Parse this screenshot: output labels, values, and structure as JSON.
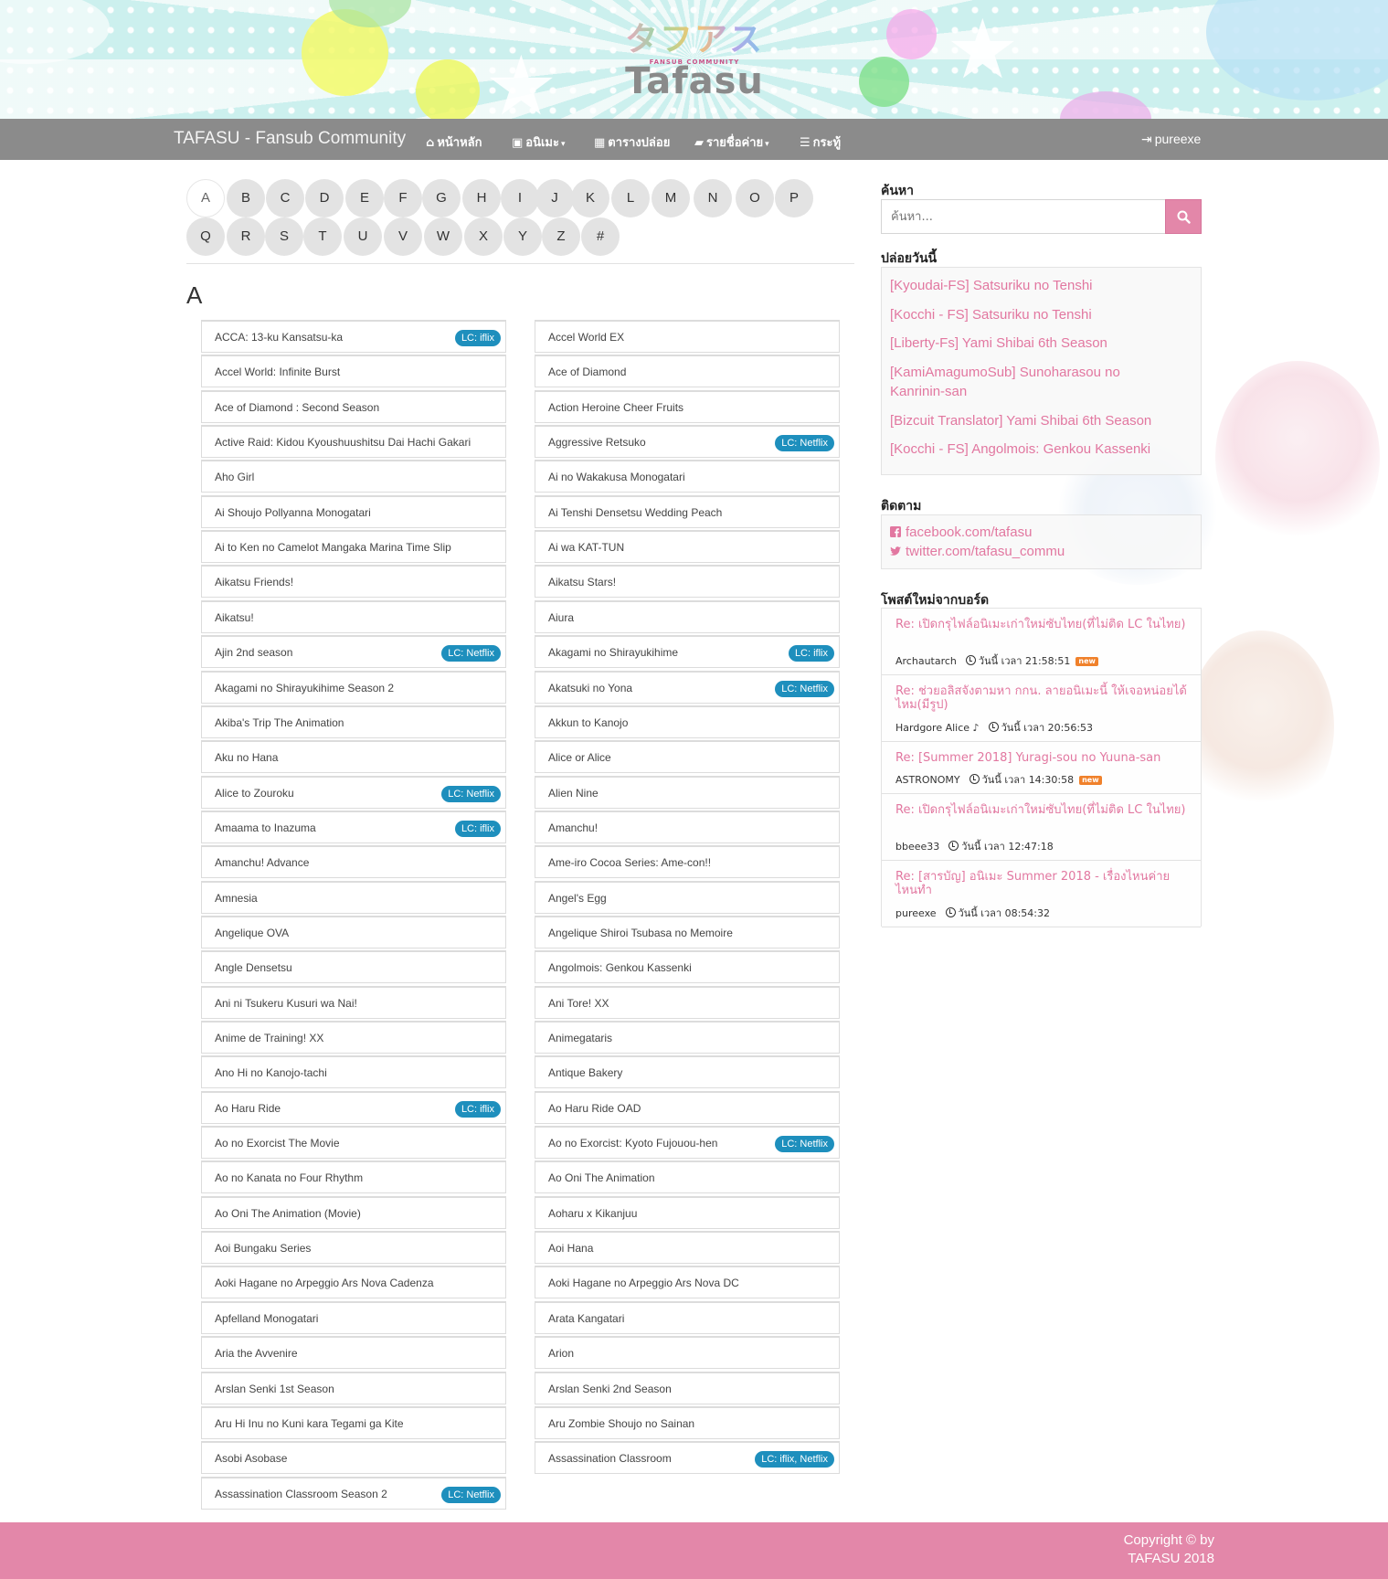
{
  "banner": {
    "logo_jp": "タフアス",
    "logo_sub": "FANSUB COMMUNITY",
    "logo_en": "Tafasu"
  },
  "navbar": {
    "brand": "TAFASU - Fansub Community",
    "items": [
      {
        "label": "หน้าหลัก",
        "icon": "home-icon"
      },
      {
        "label": "อนิเมะ",
        "icon": "film-icon",
        "caret": true
      },
      {
        "label": "ตารางปล่อย",
        "icon": "calendar-icon"
      },
      {
        "label": "รายชื่อค่าย",
        "icon": "folder-open-icon",
        "caret": true
      },
      {
        "label": "กระทู้",
        "icon": "bars-icon"
      }
    ],
    "user": "pureexe"
  },
  "letters": [
    "A",
    "B",
    "C",
    "D",
    "E",
    "F",
    "G",
    "H",
    "I",
    "J",
    "K",
    "L",
    "M",
    "N",
    "O",
    "P",
    "Q",
    "R",
    "S",
    "T",
    "U",
    "V",
    "W",
    "X",
    "Y",
    "Z",
    "#"
  ],
  "active_letter": "A",
  "heading": "A",
  "left_list": [
    {
      "title": "ACCA: 13-ku Kansatsu-ka",
      "badge": "LC: iflix"
    },
    {
      "title": "Accel World: Infinite Burst",
      "badge": ""
    },
    {
      "title": "Ace of Diamond : Second Season",
      "badge": ""
    },
    {
      "title": "Active Raid: Kidou Kyoushuushitsu Dai Hachi Gakari",
      "badge": ""
    },
    {
      "title": "Aho Girl",
      "badge": ""
    },
    {
      "title": "Ai Shoujo Pollyanna Monogatari",
      "badge": ""
    },
    {
      "title": "Ai to Ken no Camelot Mangaka Marina Time Slip",
      "badge": ""
    },
    {
      "title": "Aikatsu Friends!",
      "badge": ""
    },
    {
      "title": "Aikatsu!",
      "badge": ""
    },
    {
      "title": "Ajin 2nd season",
      "badge": "LC: Netflix"
    },
    {
      "title": "Akagami no Shirayukihime Season 2",
      "badge": ""
    },
    {
      "title": "Akiba's Trip The Animation",
      "badge": ""
    },
    {
      "title": "Aku no Hana",
      "badge": ""
    },
    {
      "title": "Alice to Zouroku",
      "badge": "LC: Netflix"
    },
    {
      "title": "Amaama to Inazuma",
      "badge": "LC: iflix"
    },
    {
      "title": "Amanchu! Advance",
      "badge": ""
    },
    {
      "title": "Amnesia",
      "badge": ""
    },
    {
      "title": "Angelique OVA",
      "badge": ""
    },
    {
      "title": "Angle Densetsu",
      "badge": ""
    },
    {
      "title": "Ani ni Tsukeru Kusuri wa Nai!",
      "badge": ""
    },
    {
      "title": "Anime de Training! XX",
      "badge": ""
    },
    {
      "title": "Ano Hi no Kanojo-tachi",
      "badge": ""
    },
    {
      "title": "Ao Haru Ride",
      "badge": "LC: iflix"
    },
    {
      "title": "Ao no Exorcist The Movie",
      "badge": ""
    },
    {
      "title": "Ao no Kanata no Four Rhythm",
      "badge": ""
    },
    {
      "title": "Ao Oni The Animation (Movie)",
      "badge": ""
    },
    {
      "title": "Aoi Bungaku Series",
      "badge": ""
    },
    {
      "title": "Aoki Hagane no Arpeggio Ars Nova Cadenza",
      "badge": ""
    },
    {
      "title": "Apfelland Monogatari",
      "badge": ""
    },
    {
      "title": "Aria the Avvenire",
      "badge": ""
    },
    {
      "title": "Arslan Senki 1st Season",
      "badge": ""
    },
    {
      "title": "Aru Hi Inu no Kuni kara Tegami ga Kite",
      "badge": ""
    },
    {
      "title": "Asobi Asobase",
      "badge": ""
    },
    {
      "title": "Assassination Classroom Season 2",
      "badge": "LC: Netflix"
    }
  ],
  "right_list": [
    {
      "title": "Accel World EX",
      "badge": ""
    },
    {
      "title": "Ace of Diamond",
      "badge": ""
    },
    {
      "title": "Action Heroine Cheer Fruits",
      "badge": ""
    },
    {
      "title": "Aggressive Retsuko",
      "badge": "LC: Netflix"
    },
    {
      "title": "Ai no Wakakusa Monogatari",
      "badge": ""
    },
    {
      "title": "Ai Tenshi Densetsu Wedding Peach",
      "badge": ""
    },
    {
      "title": "Ai wa KAT-TUN",
      "badge": ""
    },
    {
      "title": "Aikatsu Stars!",
      "badge": ""
    },
    {
      "title": "Aiura",
      "badge": ""
    },
    {
      "title": "Akagami no Shirayukihime",
      "badge": "LC: iflix"
    },
    {
      "title": "Akatsuki no Yona",
      "badge": "LC: Netflix"
    },
    {
      "title": "Akkun to Kanojo",
      "badge": ""
    },
    {
      "title": "Alice or Alice",
      "badge": ""
    },
    {
      "title": "Alien Nine",
      "badge": ""
    },
    {
      "title": "Amanchu!",
      "badge": ""
    },
    {
      "title": "Ame-iro Cocoa Series: Ame-con!!",
      "badge": ""
    },
    {
      "title": "Angel's Egg",
      "badge": ""
    },
    {
      "title": "Angelique Shiroi Tsubasa no Memoire",
      "badge": ""
    },
    {
      "title": "Angolmois: Genkou Kassenki",
      "badge": ""
    },
    {
      "title": "Ani Tore! XX",
      "badge": ""
    },
    {
      "title": "Animegataris",
      "badge": ""
    },
    {
      "title": "Antique Bakery",
      "badge": ""
    },
    {
      "title": "Ao Haru Ride OAD",
      "badge": ""
    },
    {
      "title": "Ao no Exorcist: Kyoto Fujouou-hen",
      "badge": "LC: Netflix"
    },
    {
      "title": "Ao Oni The Animation",
      "badge": ""
    },
    {
      "title": "Aoharu x Kikanjuu",
      "badge": ""
    },
    {
      "title": "Aoi Hana",
      "badge": ""
    },
    {
      "title": "Aoki Hagane no Arpeggio Ars Nova DC",
      "badge": ""
    },
    {
      "title": "Arata Kangatari",
      "badge": ""
    },
    {
      "title": "Arion",
      "badge": ""
    },
    {
      "title": "Arslan Senki 2nd Season",
      "badge": ""
    },
    {
      "title": "Aru Zombie Shoujo no Sainan",
      "badge": ""
    },
    {
      "title": "Assassination Classroom",
      "badge": "LC: iflix, Netflix"
    }
  ],
  "sidebar": {
    "search_title": "ค้นหา",
    "search_placeholder": "ค้นหา...",
    "release_title": "ปล่อยวันนี้",
    "releases": [
      "[Kyoudai-FS] Satsuriku no Tenshi",
      "[Kocchi - FS] Satsuriku no Tenshi",
      "[Liberty-Fs] Yami Shibai 6th Season",
      "[KamiAmagumoSub] Sunoharasou no Kanrinin-san",
      "[Bizcuit Translator] Yami Shibai 6th Season",
      "[Kocchi - FS] Angolmois: Genkou Kassenki"
    ],
    "follow_title": "ติดตาม",
    "follow": [
      {
        "label": "facebook.com/tafasu",
        "icon": "facebook-icon"
      },
      {
        "label": "twitter.com/tafasu_commu",
        "icon": "twitter-icon"
      }
    ],
    "posts_title": "โพสต์ใหม่จากบอร์ด",
    "posts": [
      {
        "title": "Re: เปิดกรุไฟล์อนิเมะเก่าใหม่ซับไทย(ที่ไม่ติด LC ในไทย)",
        "author": "Archautarch",
        "time": "วันนี้ เวลา 21:58:51",
        "new": "new"
      },
      {
        "title": "Re: ช่วยอลิสจังตามหา กกน. ลายอนิเมะนี้ ให้เจอหน่อยได้ไหม(มีรูป)",
        "author": "Hardgore Alice ♪",
        "time": "วันนี้ เวลา 20:56:53",
        "new": ""
      },
      {
        "title": "Re: [Summer 2018] Yuragi-sou no Yuuna-san",
        "author": "ASTRONOMY",
        "time": "วันนี้ เวลา 14:30:58",
        "new": "new"
      },
      {
        "title": "Re: เปิดกรุไฟล์อนิเมะเก่าใหม่ซับไทย(ที่ไม่ติด LC ในไทย)",
        "author": "bbeee33",
        "time": "วันนี้ เวลา 12:47:18",
        "new": ""
      },
      {
        "title": "Re: [สารบัญ] อนิเมะ Summer 2018 - เรื่องไหนค่ายไหนทำ",
        "author": "pureexe",
        "time": "วันนี้ เวลา 08:54:32",
        "new": ""
      }
    ]
  },
  "footer": {
    "line1": "Copyright © by",
    "line2": "TAFASU 2018"
  },
  "colors": {
    "navbar": "#8b8b8b",
    "accent_pink": "#e387a9",
    "link_pink": "#e277a0",
    "badge_blue": "#1e8fbd",
    "new_orange": "#f0812b"
  }
}
